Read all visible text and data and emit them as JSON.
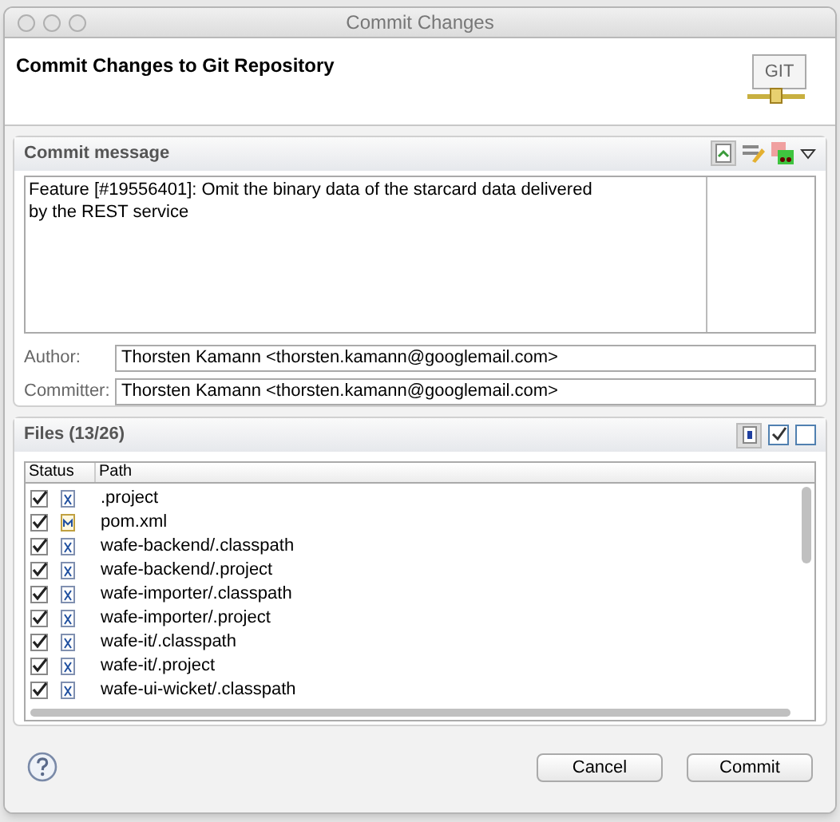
{
  "window": {
    "title": "Commit Changes"
  },
  "header": {
    "title": "Commit Changes to Git Repository",
    "logo_text": "GIT"
  },
  "commit_message": {
    "title": "Commit message",
    "text": "Feature [#19556401]: Omit the binary data of the starcard data delivered\nby the REST service"
  },
  "author": {
    "label": "Author:",
    "value": "Thorsten Kamann <thorsten.kamann@googlemail.com>"
  },
  "committer": {
    "label": "Committer:",
    "value": "Thorsten Kamann <thorsten.kamann@googlemail.com>"
  },
  "files": {
    "title": "Files (13/26)",
    "columns": [
      "Status",
      "Path"
    ],
    "rows": [
      {
        "path": ".project",
        "checked": true,
        "kind": "file"
      },
      {
        "path": "pom.xml",
        "checked": true,
        "kind": "maven"
      },
      {
        "path": "wafe-backend/.classpath",
        "checked": true,
        "kind": "file"
      },
      {
        "path": "wafe-backend/.project",
        "checked": true,
        "kind": "file"
      },
      {
        "path": "wafe-importer/.classpath",
        "checked": true,
        "kind": "file"
      },
      {
        "path": "wafe-importer/.project",
        "checked": true,
        "kind": "file"
      },
      {
        "path": "wafe-it/.classpath",
        "checked": true,
        "kind": "file"
      },
      {
        "path": "wafe-it/.project",
        "checked": true,
        "kind": "file"
      },
      {
        "path": "wafe-ui-wicket/.classpath",
        "checked": true,
        "kind": "file"
      }
    ]
  },
  "buttons": [
    "Cancel",
    "Commit"
  ]
}
